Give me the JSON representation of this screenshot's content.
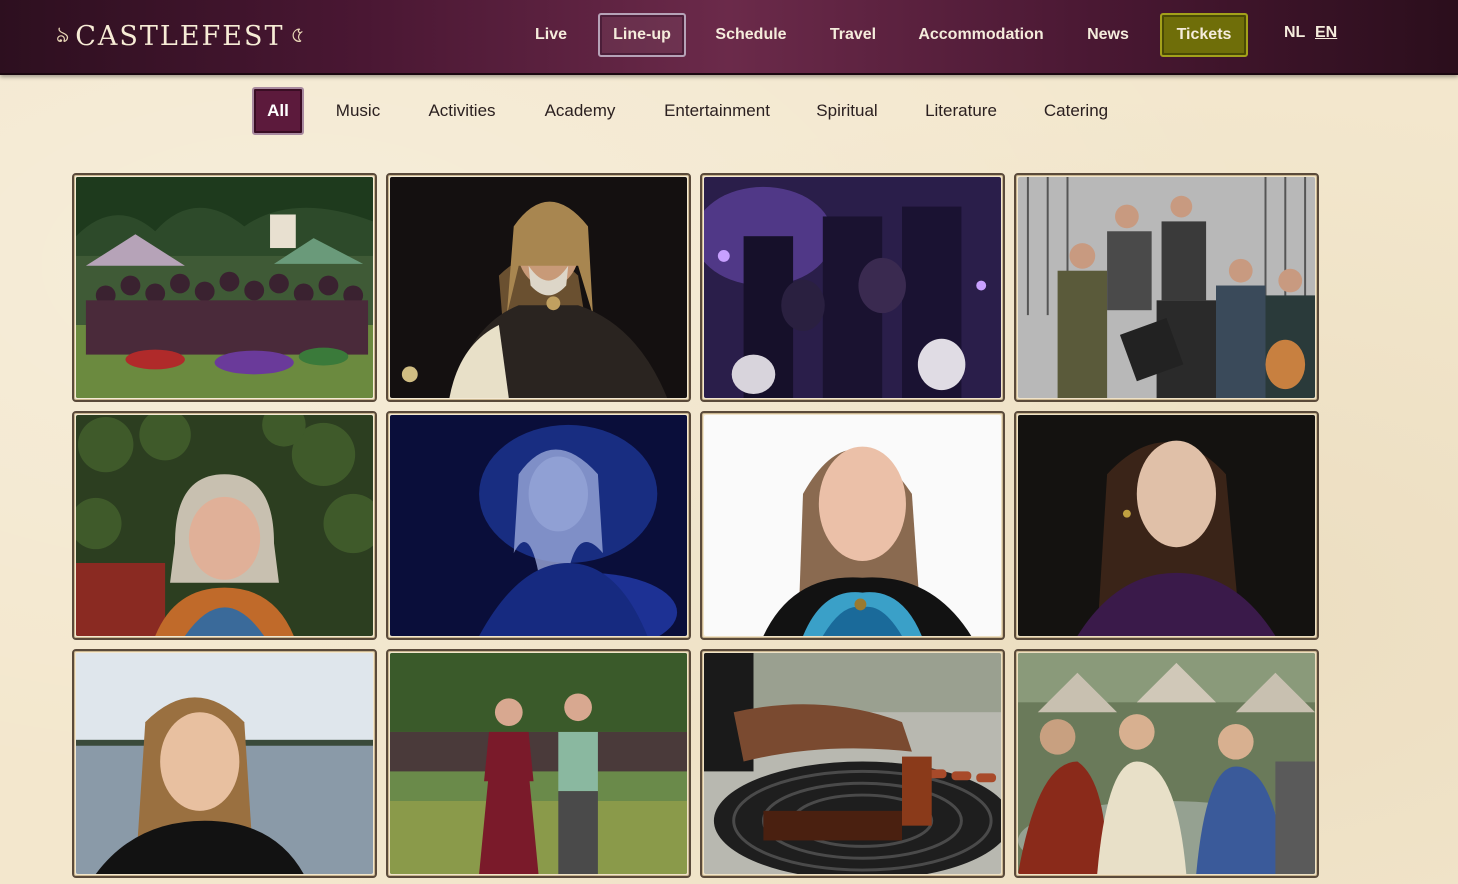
{
  "brand": {
    "name": "CASTLEFEST",
    "flourish_left": "ঌ",
    "flourish_right": "৫"
  },
  "nav": {
    "items": [
      {
        "label": "Live"
      },
      {
        "label": "Line-up",
        "active": true
      },
      {
        "label": "Schedule"
      },
      {
        "label": "Travel"
      },
      {
        "label": "Accommodation"
      },
      {
        "label": "News"
      },
      {
        "label": "Tickets"
      }
    ],
    "languages": [
      {
        "label": "NL"
      },
      {
        "label": "EN",
        "selected": true
      }
    ]
  },
  "filters": {
    "items": [
      {
        "label": "All",
        "active": true
      },
      {
        "label": "Music"
      },
      {
        "label": "Activities"
      },
      {
        "label": "Academy"
      },
      {
        "label": "Entertainment"
      },
      {
        "label": "Spiritual"
      },
      {
        "label": "Literature"
      },
      {
        "label": "Catering"
      }
    ]
  },
  "colors": {
    "header_dark": "#2d0f1f",
    "accent_plum": "#5c1a3c",
    "tickets_olive": "#6f6e09",
    "page_background": "#f3e7cd"
  },
  "grid": {
    "tiles": [
      {
        "subject": "group-photo"
      },
      {
        "subject": "bearded-storyteller"
      },
      {
        "subject": "masked-performers"
      },
      {
        "subject": "folk-band"
      },
      {
        "subject": "woman-ivy"
      },
      {
        "subject": "woman-blue-light"
      },
      {
        "subject": "woman-white-background"
      },
      {
        "subject": "woman-dark-background"
      },
      {
        "subject": "woman-lakeside"
      },
      {
        "subject": "couple-dancing"
      },
      {
        "subject": "barbecue-grill"
      },
      {
        "subject": "tents-trio"
      }
    ]
  }
}
